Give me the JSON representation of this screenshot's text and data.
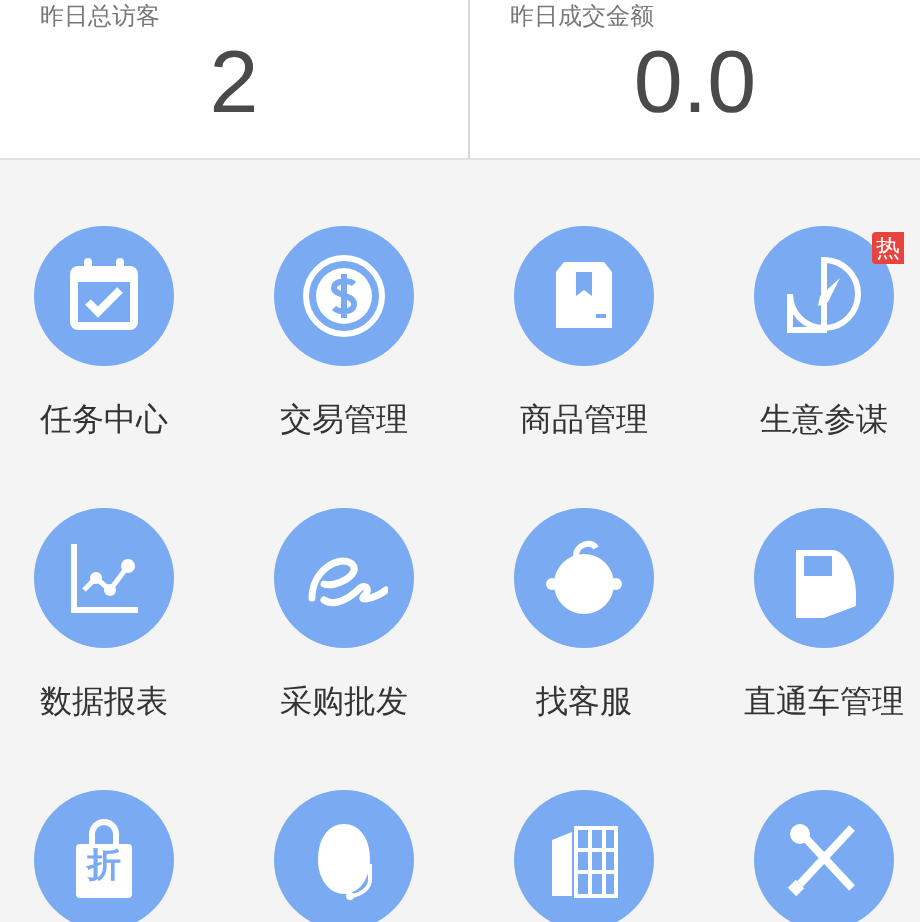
{
  "stats": [
    {
      "label": "昨日总访客",
      "value": "2"
    },
    {
      "label": "昨日成交金额",
      "value": "0.0"
    }
  ],
  "items": [
    {
      "kind": "labeled",
      "label": "任务中心"
    },
    {
      "kind": "labeled",
      "label": "交易管理"
    },
    {
      "kind": "labeled",
      "label": "商品管理"
    },
    {
      "kind": "labeled",
      "label": "生意参谋",
      "badge": "热"
    },
    {
      "kind": "labeled",
      "label": "数据报表"
    },
    {
      "kind": "labeled",
      "label": "采购批发"
    },
    {
      "kind": "labeled",
      "label": "找客服"
    },
    {
      "kind": "labeled",
      "label": "直通车管理"
    },
    {
      "kind": "icon",
      "icon_text": "折"
    },
    {
      "kind": "icon"
    },
    {
      "kind": "icon"
    },
    {
      "kind": "icon"
    }
  ]
}
